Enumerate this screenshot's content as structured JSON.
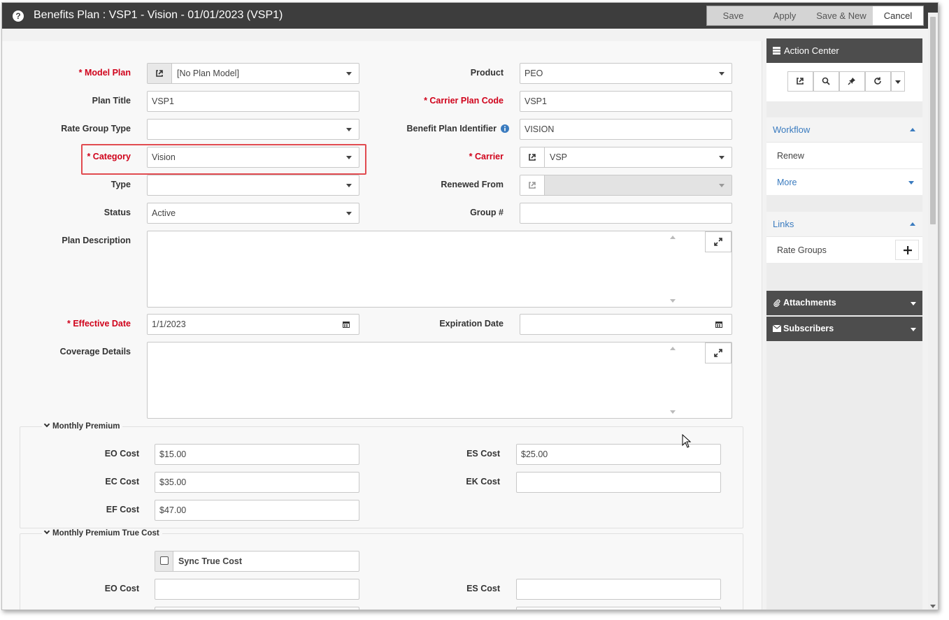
{
  "window": {
    "title": "Benefits Plan : VSP1 - Vision - 01/01/2023 (VSP1)",
    "buttons": {
      "save": "Save",
      "apply": "Apply",
      "save_new": "Save & New",
      "cancel": "Cancel"
    }
  },
  "form": {
    "model_plan": {
      "label": "* Model Plan",
      "value": "[No Plan Model]"
    },
    "product": {
      "label": "Product",
      "value": "PEO"
    },
    "plan_title": {
      "label": "Plan Title",
      "value": "VSP1"
    },
    "carrier_plan_code": {
      "label": "* Carrier Plan Code",
      "value": "VSP1"
    },
    "rate_group_type": {
      "label": "Rate Group Type",
      "value": ""
    },
    "benefit_plan_identifier": {
      "label": "Benefit Plan Identifier",
      "value": "VISION"
    },
    "category": {
      "label": "* Category",
      "value": "Vision"
    },
    "carrier": {
      "label": "* Carrier",
      "value": "VSP"
    },
    "type": {
      "label": "Type",
      "value": ""
    },
    "renewed_from": {
      "label": "Renewed From",
      "value": ""
    },
    "status": {
      "label": "Status",
      "value": "Active"
    },
    "group_no": {
      "label": "Group #",
      "value": ""
    },
    "plan_description": {
      "label": "Plan Description",
      "value": ""
    },
    "effective_date": {
      "label": "* Effective Date",
      "value": "1/1/2023"
    },
    "expiration_date": {
      "label": "Expiration Date",
      "value": ""
    },
    "coverage_details": {
      "label": "Coverage Details",
      "value": ""
    }
  },
  "monthly_premium": {
    "title": "Monthly Premium",
    "eo_cost": {
      "label": "EO Cost",
      "value": "$15.00"
    },
    "es_cost": {
      "label": "ES Cost",
      "value": "$25.00"
    },
    "ec_cost": {
      "label": "EC Cost",
      "value": "$35.00"
    },
    "ek_cost": {
      "label": "EK Cost",
      "value": ""
    },
    "ef_cost": {
      "label": "EF Cost",
      "value": "$47.00"
    }
  },
  "monthly_premium_true_cost": {
    "title": "Monthly Premium True Cost",
    "sync_true_cost": {
      "label": "Sync True Cost",
      "checked": false
    },
    "eo_cost": {
      "label": "EO Cost",
      "value": ""
    },
    "es_cost": {
      "label": "ES Cost",
      "value": ""
    }
  },
  "sidebar": {
    "action_center": "Action Center",
    "workflow": {
      "title": "Workflow",
      "items": [
        "Renew",
        "More"
      ]
    },
    "links": {
      "title": "Links",
      "items": [
        "Rate Groups"
      ]
    },
    "attachments": "Attachments",
    "subscribers": "Subscribers"
  }
}
